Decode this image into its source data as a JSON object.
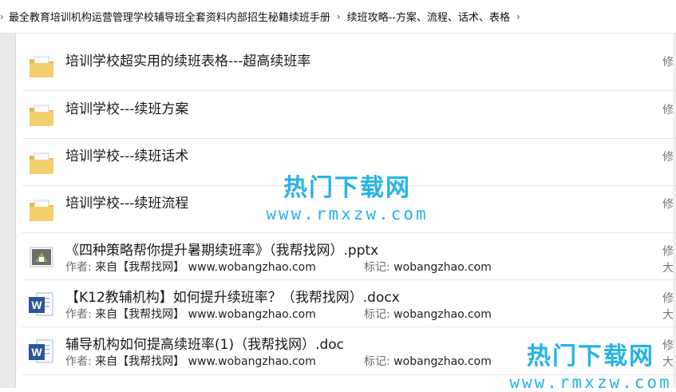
{
  "breadcrumb": {
    "items": [
      "最全教育培训机构运营管理学校辅导班全套资料内部招生秘籍续班手册",
      "续班攻略--方案、流程、话术、表格"
    ]
  },
  "files": [
    {
      "icon": "folder-icon",
      "name": "培训学校超实用的续班表格---超高续班率",
      "side": "修"
    },
    {
      "icon": "folder-icon",
      "name": "培训学校---续班方案",
      "side": "修"
    },
    {
      "icon": "folder-icon",
      "name": "培训学校---续班话术",
      "side": "修"
    },
    {
      "icon": "folder-icon",
      "name": "培训学校---续班流程",
      "side": "修"
    },
    {
      "icon": "pptx-file-icon",
      "name": "《四种策略帮你提升暑期续班率》（我帮找网）.pptx",
      "author_label": "作者:",
      "author": "来自【我帮找网】 www.wobangzhao.com",
      "tag_label": "标记:",
      "tag": "wobangzhao.com",
      "side": "修",
      "side2": "大"
    },
    {
      "icon": "docx-file-icon",
      "name": "【K12教辅机构】如何提升续班率？（我帮找网）.docx",
      "author_label": "作者:",
      "author": "来自【我帮找网】 www.wobangzhao.com",
      "tag_label": "标记:",
      "tag": "wobangzhao.com",
      "side": "修",
      "side2": "大"
    },
    {
      "icon": "doc-file-icon",
      "name": "辅导机构如何提高续班率(1)（我帮找网）.doc",
      "author_label": "作者:",
      "author": "来自【我帮找网】 www.wobangzhao.com",
      "tag_label": "标记:",
      "tag": "wobangzhao.com",
      "side": "修",
      "side2": "大"
    }
  ],
  "watermarks": [
    {
      "text": "热门下载网",
      "url": "www.rmxzw.com"
    },
    {
      "text": "热门下载网",
      "url": "www.rmxzw.com"
    }
  ],
  "colors": {
    "watermark": "#27b3e8",
    "folder": "#f2cf6b",
    "word_blue": "#2b579a"
  }
}
